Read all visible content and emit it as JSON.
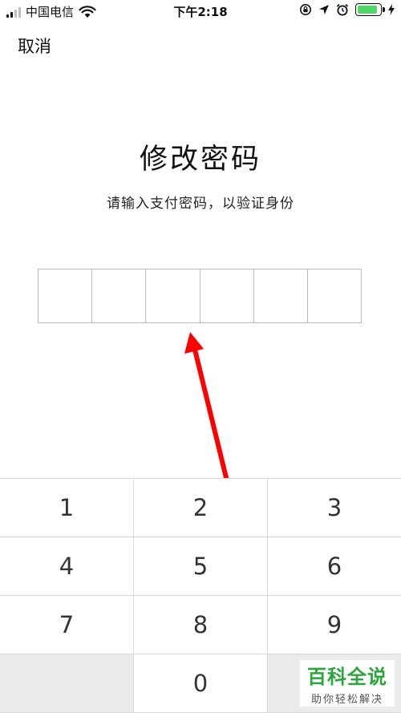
{
  "status_bar": {
    "carrier": "中国电信",
    "time": "下午2:18",
    "battery_color": "#4cd964"
  },
  "header": {
    "cancel_label": "取消"
  },
  "main": {
    "title": "修改密码",
    "subtitle": "请输入支付密码，以验证身份",
    "pin_length": 6
  },
  "keypad": {
    "rows": [
      [
        "1",
        "2",
        "3"
      ],
      [
        "4",
        "5",
        "6"
      ],
      [
        "7",
        "8",
        "9"
      ],
      [
        "",
        "0",
        ""
      ]
    ]
  },
  "watermark": {
    "main_text": "百科全说",
    "sub_text": "助你轻松解决"
  },
  "annotation": {
    "arrow_color": "#ff0000"
  }
}
